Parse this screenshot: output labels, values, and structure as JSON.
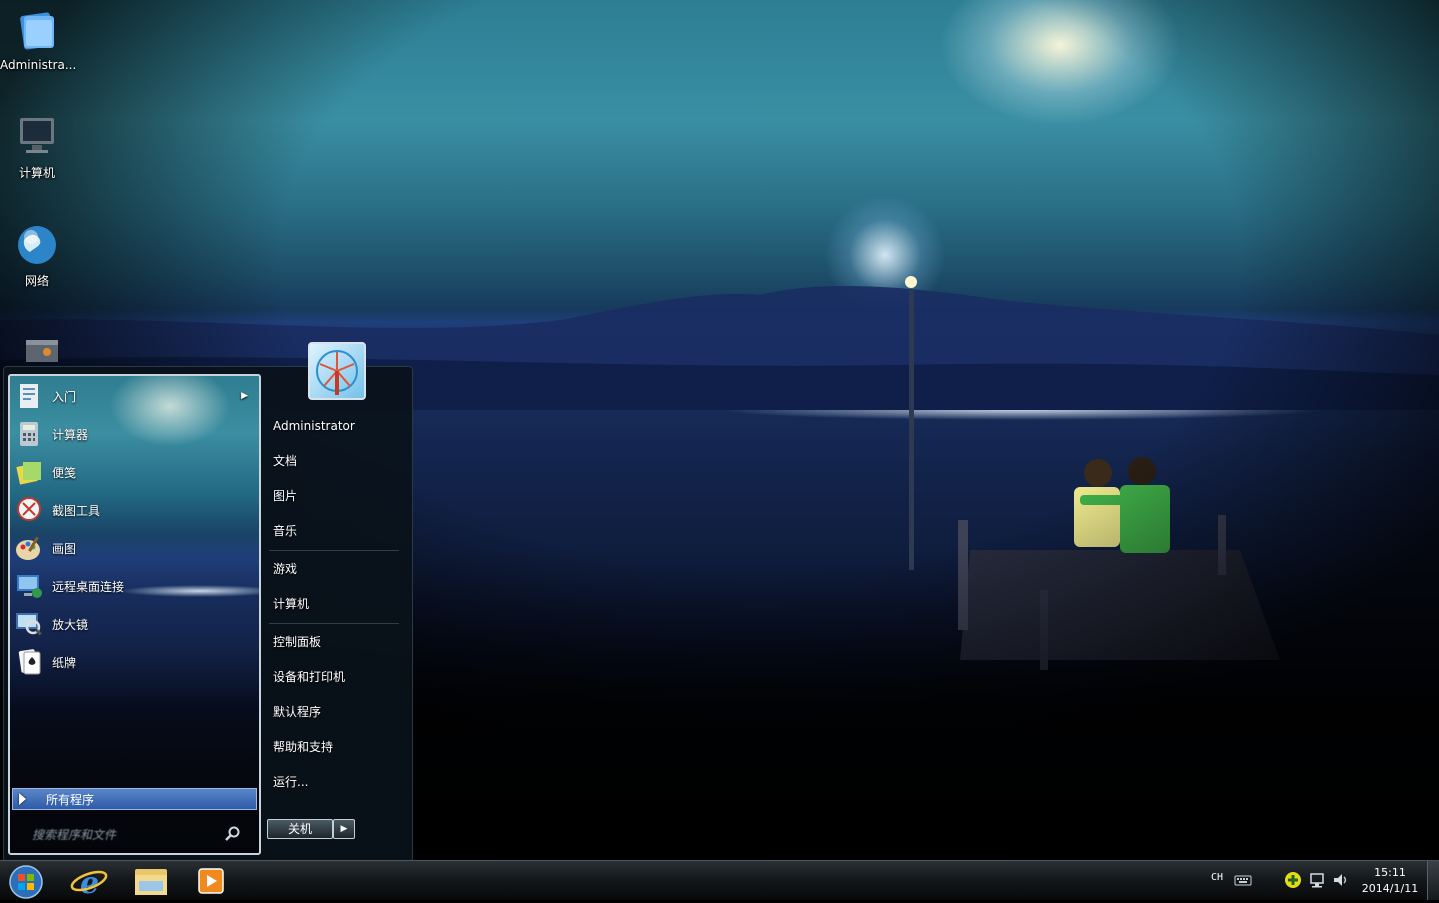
{
  "desktop": {
    "icons": [
      {
        "label": "Administra...",
        "icon": "user-folder-icon"
      },
      {
        "label": "计算机",
        "icon": "computer-icon"
      },
      {
        "label": "网络",
        "icon": "network-globe-icon"
      },
      {
        "label": "",
        "icon": "recycle-bin-icon"
      }
    ]
  },
  "start_menu": {
    "programs": [
      {
        "label": "入门",
        "icon": "getting-started-icon",
        "has_submenu": true
      },
      {
        "label": "计算器",
        "icon": "calculator-icon"
      },
      {
        "label": "便笺",
        "icon": "sticky-notes-icon"
      },
      {
        "label": "截图工具",
        "icon": "snipping-tool-icon"
      },
      {
        "label": "画图",
        "icon": "paint-icon"
      },
      {
        "label": "远程桌面连接",
        "icon": "remote-desktop-icon"
      },
      {
        "label": "放大镜",
        "icon": "magnifier-icon"
      },
      {
        "label": "纸牌",
        "icon": "solitaire-icon"
      }
    ],
    "all_programs_label": "所有程序",
    "search_placeholder": "搜索程序和文件",
    "right_items": [
      {
        "label": "Administrator"
      },
      {
        "label": "文档"
      },
      {
        "label": "图片"
      },
      {
        "label": "音乐"
      },
      {
        "label": "游戏"
      },
      {
        "label": "计算机"
      },
      {
        "label": "控制面板"
      },
      {
        "label": "设备和打印机"
      },
      {
        "label": "默认程序"
      },
      {
        "label": "帮助和支持"
      },
      {
        "label": "运行..."
      }
    ],
    "shutdown_label": "关机",
    "shutdown_arrow": "▶"
  },
  "taskbar": {
    "start_button": "windows-orb-icon",
    "pinned": [
      "internet-explorer-icon",
      "windows-explorer-icon",
      "media-player-icon"
    ],
    "language": "CH",
    "time": "15:11",
    "date": "2014/1/11"
  },
  "colors": {
    "accent_blue": "#2e5aa8",
    "taskbar_dark": "#15191c",
    "sky_teal": "#3a8fa3"
  }
}
